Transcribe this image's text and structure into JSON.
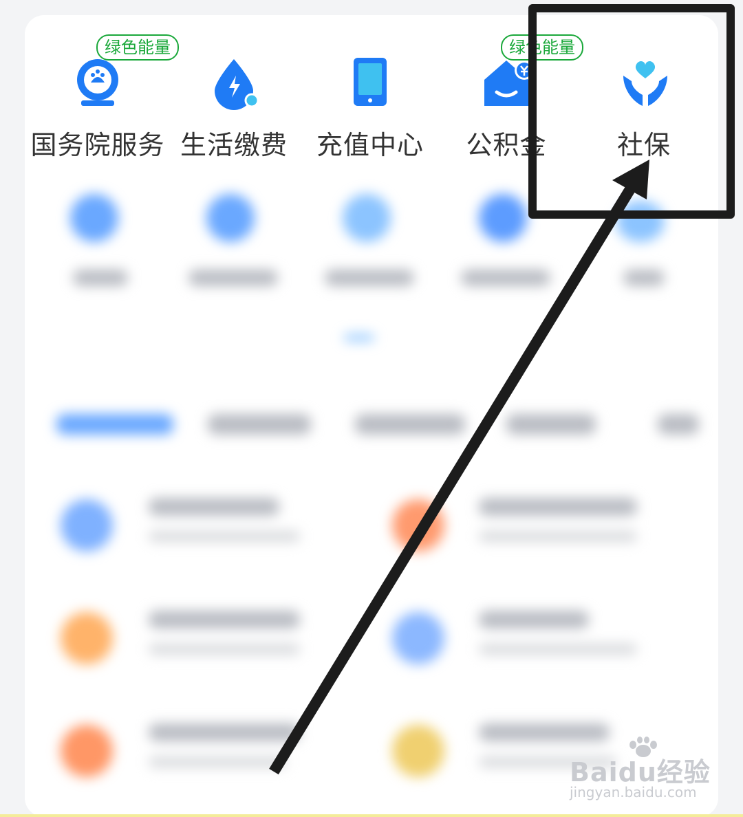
{
  "services": [
    {
      "label": "国务院服务",
      "icon": "state-council-icon",
      "badge": "绿色能量"
    },
    {
      "label": "生活缴费",
      "icon": "utility-payment-icon",
      "badge": ""
    },
    {
      "label": "充值中心",
      "icon": "phone-recharge-icon",
      "badge": ""
    },
    {
      "label": "公积金",
      "icon": "housing-fund-icon",
      "badge": "绿色能量"
    },
    {
      "label": "社保",
      "icon": "social-security-icon",
      "badge": ""
    }
  ],
  "colors": {
    "icon_blue": "#1f7bf5",
    "badge_green": "#1aa83a",
    "highlight": "#1c1c1c"
  },
  "watermark": {
    "brand": "Baidu经验",
    "url": "jingyan.baidu.com"
  }
}
